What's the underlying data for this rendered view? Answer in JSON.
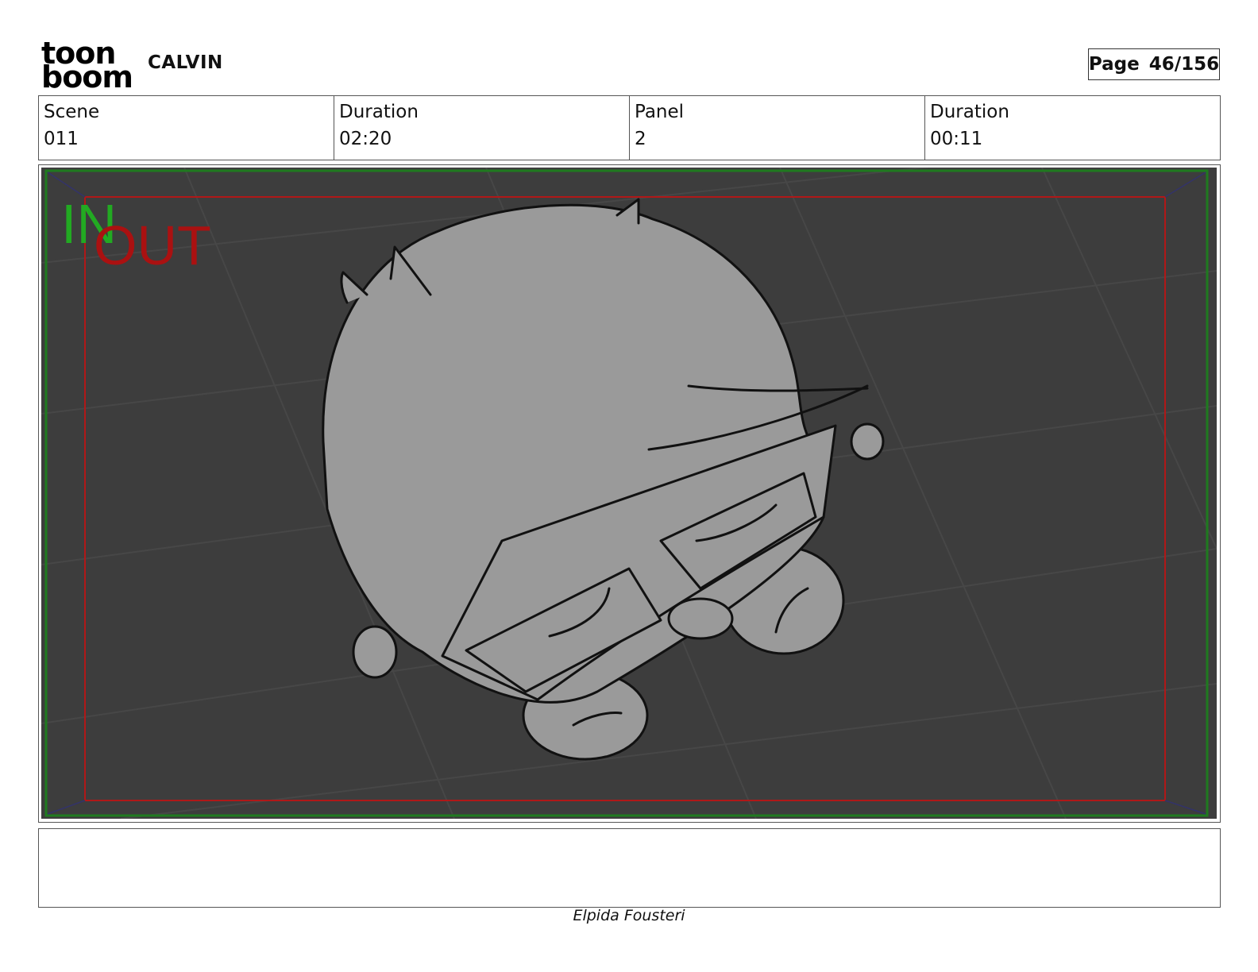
{
  "header": {
    "logo_line1": "toon",
    "logo_line2": "boom",
    "project": "CALVIN",
    "page_label": "Page",
    "page_value": "46/156"
  },
  "info": {
    "scene_label": "Scene",
    "scene_value": "011",
    "scene_duration_label": "Duration",
    "scene_duration_value": "02:20",
    "panel_label": "Panel",
    "panel_value": "2",
    "panel_duration_label": "Duration",
    "panel_duration_value": "00:11"
  },
  "panel_image": {
    "in_label": "IN",
    "out_label": "OUT",
    "colors": {
      "background": "#3d3d3d",
      "grid": "#454545",
      "character_fill": "#9a9a9a",
      "in_frame": "#1f7a1f",
      "out_frame": "#b01818",
      "in_text": "#22aa22",
      "out_text": "#aa1111"
    }
  },
  "footer": {
    "artist": "Elpida Fousteri"
  }
}
